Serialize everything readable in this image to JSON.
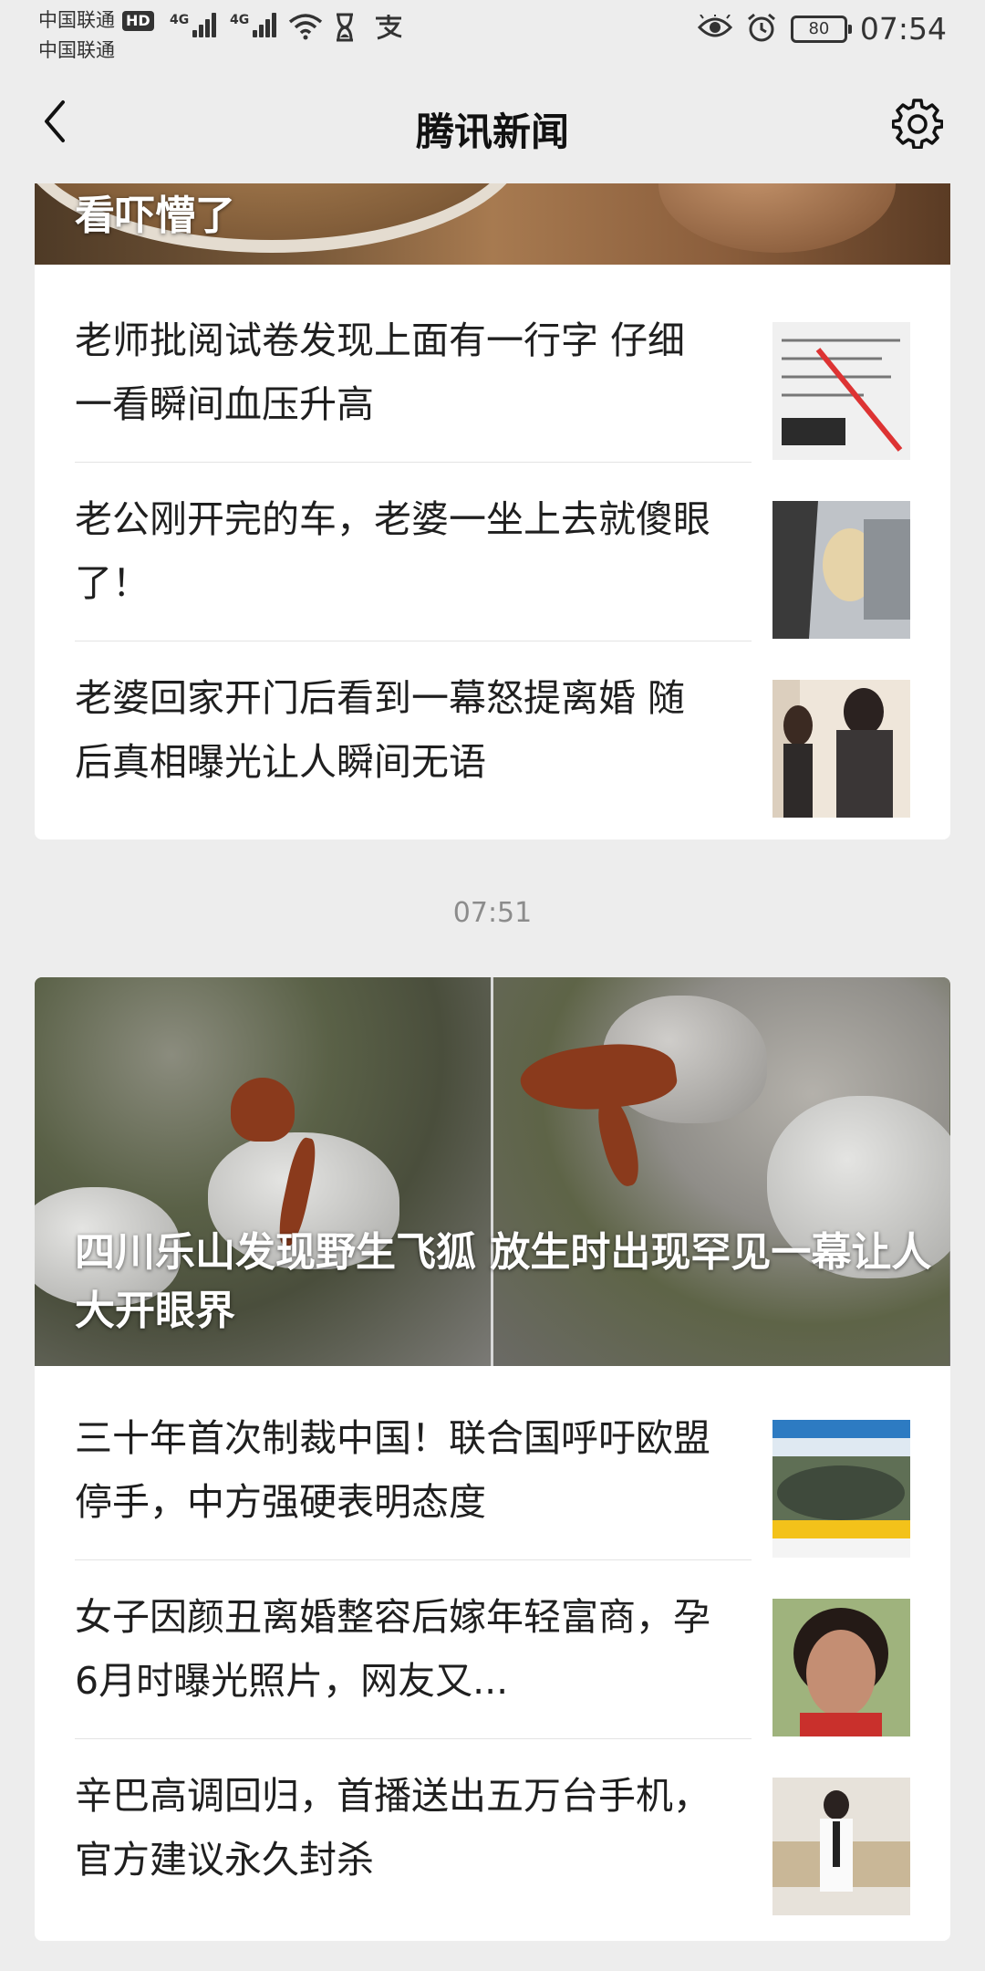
{
  "status_bar": {
    "carrier_1": "中国联通",
    "carrier_2": "中国联通",
    "hd_badge": "HD",
    "network_1": "4G",
    "network_2": "4G",
    "battery": "80",
    "time": "07:54"
  },
  "nav": {
    "title": "腾讯新闻"
  },
  "feed": {
    "group_1": {
      "hero_title": "看吓懵了",
      "items": [
        {
          "title": "老师批阅试卷发现上面有一行字 仔细一看瞬间血压升高"
        },
        {
          "title": "老公刚开完的车，老婆一坐上去就傻眼了！"
        },
        {
          "title": "老婆回家开门后看到一幕怒提离婚 随后真相曝光让人瞬间无语"
        }
      ]
    },
    "timestamp": "07:51",
    "group_2": {
      "hero_title": "四川乐山发现野生飞狐 放生时出现罕见一幕让人大开眼界",
      "items": [
        {
          "title": "三十年首次制裁中国！联合国呼吁欧盟停手，中方强硬表明态度"
        },
        {
          "title": "女子因颜丑离婚整容后嫁年轻富商，孕6月时曝光照片，网友又..."
        },
        {
          "title": "辛巴高调回归，首播送出五万台手机，官方建议永久封杀"
        }
      ]
    }
  }
}
